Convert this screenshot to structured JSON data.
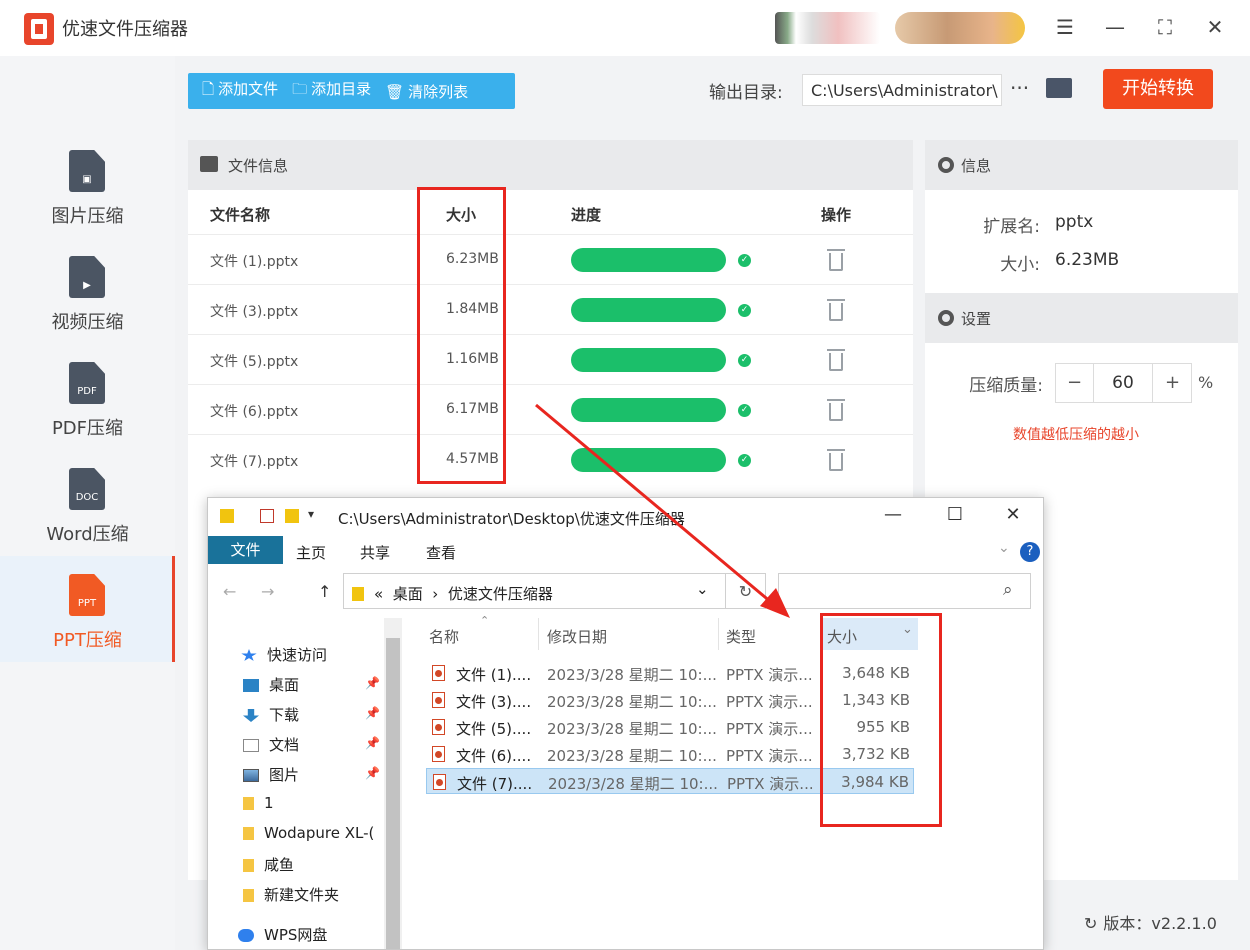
{
  "app": {
    "title": "优速文件压缩器",
    "version_label": "版本：",
    "version": "v2.2.1.0",
    "colors": {
      "accent": "#f2491d",
      "primary_blue": "#3ab0ec",
      "progress_green": "#1bbf6a",
      "highlight_red": "#e8261f"
    }
  },
  "window_controls": {
    "menu": "☰",
    "minimize": "—",
    "maximize": "⛶",
    "close": "✕"
  },
  "sidebar": {
    "items": [
      {
        "label": "图片压缩",
        "icon": "image-file-icon",
        "badge": "▣"
      },
      {
        "label": "视频压缩",
        "icon": "video-file-icon",
        "badge": "▶"
      },
      {
        "label": "PDF压缩",
        "icon": "pdf-file-icon",
        "badge": "PDF"
      },
      {
        "label": "Word压缩",
        "icon": "doc-file-icon",
        "badge": "DOC"
      },
      {
        "label": "PPT压缩",
        "icon": "ppt-file-icon",
        "badge": "PPT",
        "active": true
      }
    ]
  },
  "toolbar": {
    "add_file": "添加文件",
    "add_folder": "添加目录",
    "clear_list": "清除列表",
    "output_label": "输出目录:",
    "output_path": "C:\\Users\\Administrator\\",
    "more": "···",
    "start": "开始转换"
  },
  "file_panel": {
    "title": "文件信息",
    "columns": {
      "name": "文件名称",
      "size": "大小",
      "progress": "进度",
      "action": "操作"
    },
    "rows": [
      {
        "name": "文件 (1).pptx",
        "size": "6.23MB",
        "progress": 1.0,
        "status": "✓"
      },
      {
        "name": "文件 (3).pptx",
        "size": "1.84MB",
        "progress": 1.0,
        "status": "✓"
      },
      {
        "name": "文件 (5).pptx",
        "size": "1.16MB",
        "progress": 1.0,
        "status": "✓"
      },
      {
        "name": "文件 (6).pptx",
        "size": "6.17MB",
        "progress": 1.0,
        "status": "✓"
      },
      {
        "name": "文件 (7).pptx",
        "size": "4.57MB",
        "progress": 1.0,
        "status": "✓"
      }
    ]
  },
  "info_panel": {
    "title": "信息",
    "ext_label": "扩展名:",
    "ext_value": "pptx",
    "size_label": "大小:",
    "size_value": "6.23MB"
  },
  "settings_panel": {
    "title": "设置",
    "quality_label": "压缩质量:",
    "minus": "−",
    "quality_value": "60",
    "plus": "+",
    "unit": "%",
    "hint": "数值越低压缩的越小"
  },
  "explorer": {
    "title": "C:\\Users\\Administrator\\Desktop\\优速文件压缩器",
    "controls": {
      "minimize": "—",
      "maximize": "☐",
      "close": "✕"
    },
    "ribbon": {
      "file": "文件",
      "home": "主页",
      "share": "共享",
      "view": "查看",
      "help": "?"
    },
    "address": {
      "prefix": "«",
      "part1": "桌面",
      "sep": "›",
      "part2": "优速文件压缩器",
      "dropdown": "⌄",
      "refresh": "↻",
      "search_icon": "⌕"
    },
    "nav": {
      "back": "←",
      "forward": "→",
      "up": "↑"
    },
    "tree": [
      {
        "label": "快速访问",
        "icon": "star-icon",
        "pinned": false
      },
      {
        "label": "桌面",
        "icon": "desktop-icon",
        "pinned": true
      },
      {
        "label": "下载",
        "icon": "download-icon",
        "pinned": true
      },
      {
        "label": "文档",
        "icon": "documents-icon",
        "pinned": true
      },
      {
        "label": "图片",
        "icon": "pictures-icon",
        "pinned": true
      },
      {
        "label": "1",
        "icon": "folder-icon",
        "pinned": false
      },
      {
        "label": "Wodapure XL-(",
        "icon": "folder-icon",
        "pinned": false
      },
      {
        "label": "咸鱼",
        "icon": "folder-icon",
        "pinned": false
      },
      {
        "label": "新建文件夹",
        "icon": "folder-icon",
        "pinned": false
      },
      {
        "label": "WPS网盘",
        "icon": "cloud-icon",
        "pinned": false
      }
    ],
    "columns": {
      "name": "名称",
      "modified": "修改日期",
      "type": "类型",
      "size": "大小"
    },
    "files": [
      {
        "name": "文件 (1)....",
        "modified": "2023/3/28 星期二 10:...",
        "type": "PPTX 演示...",
        "size": "3,648 KB"
      },
      {
        "name": "文件 (3)....",
        "modified": "2023/3/28 星期二 10:...",
        "type": "PPTX 演示...",
        "size": "1,343 KB"
      },
      {
        "name": "文件 (5)....",
        "modified": "2023/3/28 星期二 10:...",
        "type": "PPTX 演示...",
        "size": "955 KB"
      },
      {
        "name": "文件 (6)....",
        "modified": "2023/3/28 星期二 10:...",
        "type": "PPTX 演示...",
        "size": "3,732 KB"
      },
      {
        "name": "文件 (7)....",
        "modified": "2023/3/28 星期二 10:...",
        "type": "PPTX 演示...",
        "size": "3,984 KB",
        "selected": true
      }
    ]
  }
}
